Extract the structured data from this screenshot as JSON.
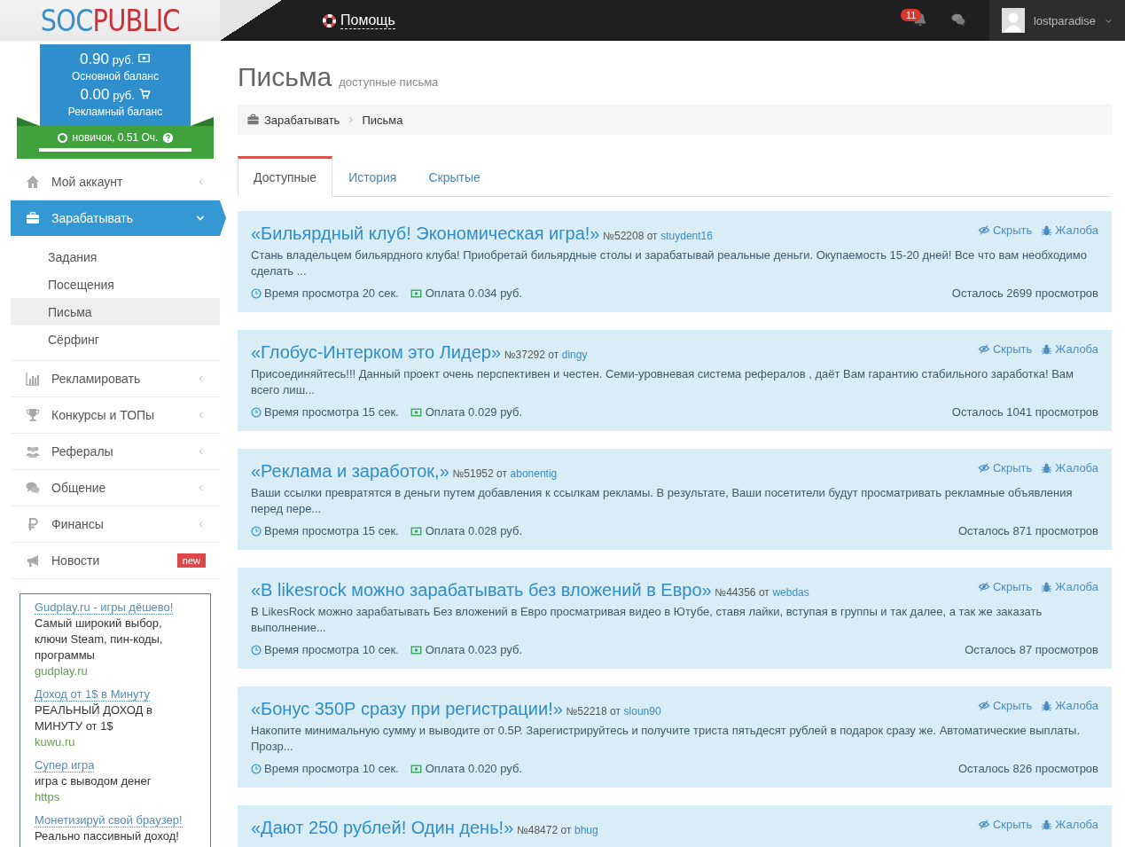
{
  "logo": {
    "part_1": "SOC",
    "part_2": "PUBLIC"
  },
  "topbar": {
    "help": "Помощь",
    "notifications": "11",
    "username": "lostparadise"
  },
  "balance": {
    "main_amount": "0.90",
    "main_currency": "руб.",
    "main_label": "Основной баланс",
    "ad_amount": "0.00",
    "ad_currency": "руб.",
    "ad_label": "Рекламный баланс",
    "rank": "новичок, 0.51 Оч.",
    "level": 1
  },
  "sidebar": {
    "items": [
      {
        "label": "Мой аккаунт",
        "selected": false,
        "expanded": false
      },
      {
        "label": "Зарабатывать",
        "selected": true,
        "expanded": true,
        "children": [
          {
            "label": "Задания",
            "selected": false
          },
          {
            "label": "Посещения",
            "selected": false
          },
          {
            "label": "Письма",
            "selected": true
          },
          {
            "label": "Сёрфинг",
            "selected": false
          }
        ]
      },
      {
        "label": "Рекламировать",
        "selected": false,
        "expanded": false
      },
      {
        "label": "Конкурсы и ТОПы",
        "selected": false,
        "expanded": false
      },
      {
        "label": "Рефералы",
        "selected": false,
        "expanded": false
      },
      {
        "label": "Общение",
        "selected": false,
        "expanded": false
      },
      {
        "label": "Финансы",
        "selected": false,
        "expanded": false
      },
      {
        "label": "Новости",
        "selected": false,
        "badge": "new"
      }
    ],
    "ads": [
      {
        "title": "Gudplay.ru - игры дёшево!",
        "text": "Самый широкий выбор, ключи Steam, пин-коды, программы",
        "url": "gudplay.ru"
      },
      {
        "title": "Доход от 1$ в Минуту",
        "text": "РЕАЛЬНЫЙ ДОХОД в МИНУТУ от 1$",
        "url": "kuwu.ru"
      },
      {
        "title": "Супер игра",
        "text": "игра с выводом денег",
        "url": "https"
      },
      {
        "title": "Монетизируй свой браузер!",
        "text": "Реально пассивный доход!"
      }
    ]
  },
  "page": {
    "title": "Письма",
    "subtitle": "доступные письма",
    "breadcrumb": [
      "Зарабатывать",
      "Письма"
    ],
    "tabs": [
      {
        "label": "Доступные",
        "selected": true
      },
      {
        "label": "История",
        "selected": false
      },
      {
        "label": "Скрытые",
        "selected": false
      }
    ]
  },
  "letters": [
    {
      "title": "«Бильярдный клуб! Экономическая игра!»",
      "number": "№52208",
      "from": "от",
      "author": "stuydent16",
      "hide": "Скрыть",
      "report": "Жалоба",
      "text": "Стань владельцем бильярдного клуба! Приобретай бильярдные столы и зарабатывай реальные деньги. Окупаемость 15-20 дней! Все что вам необходимо сделать ...",
      "time": "Время просмотра 20 сек.",
      "pay": "Оплата 0.034 руб.",
      "remaining": "Осталось 2699 просмотров"
    },
    {
      "title": "«Глобус-Интерком это Лидер»",
      "number": "№37292",
      "from": "от",
      "author": "dingy",
      "hide": "Скрыть",
      "report": "Жалоба",
      "text": "Присоединяйтесь!!! Данный проект очень перспективен и честен. Семи-уровневая система рефералов , даёт Вам гарантию стабильного заработка! Вам всего лиш...",
      "time": "Время просмотра 15 сек.",
      "pay": "Оплата 0.029 руб.",
      "remaining": "Осталось 1041 просмотров"
    },
    {
      "title": "«Реклама и заработок,»",
      "number": "№51952",
      "from": "от",
      "author": "abonentig",
      "hide": "Скрыть",
      "report": "Жалоба",
      "text": "Ваши ссылки превратятся в деньги путем добавления к ссылкам рекламы. В результате, Ваши посетители будут просматривать рекламные объявления перед пере...",
      "time": "Время просмотра 15 сек.",
      "pay": "Оплата 0.028 руб.",
      "remaining": "Осталось 871 просмотров"
    },
    {
      "title": "«В likesrock можно зарабатывать без вложений в Евро»",
      "number": "№44356",
      "from": "от",
      "author": "webdas",
      "hide": "Скрыть",
      "report": "Жалоба",
      "text": "В LikesRock можно зарабатывать Без вложений в Евро просматривая видео в Ютубе, ставя лайки, вступая в группы и так далее, а так же заказать выполнение...",
      "time": "Время просмотра 10 сек.",
      "pay": "Оплата 0.023 руб.",
      "remaining": "Осталось 87 просмотров"
    },
    {
      "title": "«Бонус 350Р сразу при регистрации!»",
      "number": "№52218",
      "from": "от",
      "author": "sloun90",
      "hide": "Скрыть",
      "report": "Жалоба",
      "text": "Накопите минимальную сумму и выводите от 0.5Р. Зарегистрируйтесь и получите триста пятьдесят рублей  в подарок сразу же. Автоматические выплаты. Прозр...",
      "time": "Время просмотра 10 сек.",
      "pay": "Оплата 0.020 руб.",
      "remaining": "Осталось 826 просмотров"
    },
    {
      "title": "«Дают 250 рублей! Один день!»",
      "number": "№48472",
      "from": "от",
      "author": "bhug",
      "hide": "Скрыть",
      "report": "Жалоба"
    }
  ]
}
